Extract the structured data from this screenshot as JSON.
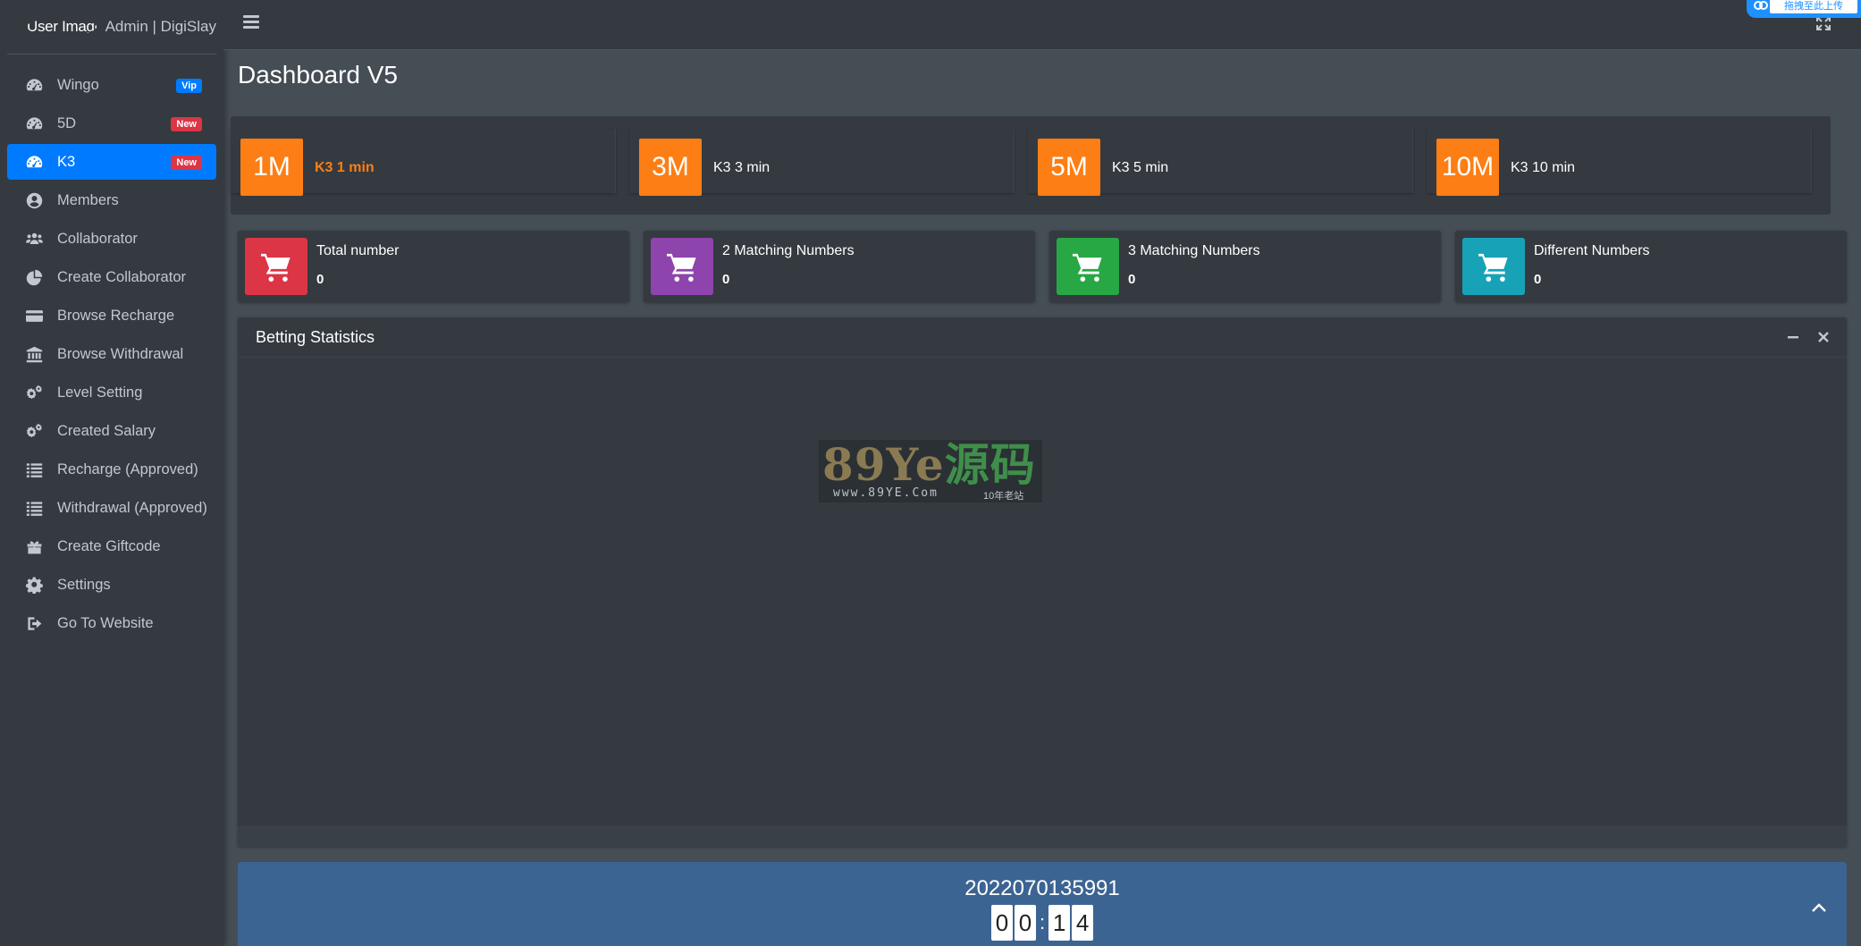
{
  "brand": {
    "image_alt": "User Image",
    "title": "Admin | DigiSlay"
  },
  "sidebar": {
    "items": [
      {
        "label": "Wingo",
        "icon": "tachometer-icon",
        "badge": "Vip",
        "badge_type": "vip",
        "active": false
      },
      {
        "label": "5D",
        "icon": "tachometer-icon",
        "badge": "New",
        "badge_type": "new",
        "active": false
      },
      {
        "label": "K3",
        "icon": "tachometer-icon",
        "badge": "New",
        "badge_type": "new",
        "active": true
      },
      {
        "label": "Members",
        "icon": "user-circle-icon",
        "active": false
      },
      {
        "label": "Collaborator",
        "icon": "users-icon",
        "active": false
      },
      {
        "label": "Create Collaborator",
        "icon": "pie-chart-icon",
        "active": false
      },
      {
        "label": "Browse Recharge",
        "icon": "credit-card-icon",
        "active": false
      },
      {
        "label": "Browse Withdrawal",
        "icon": "bank-icon",
        "active": false
      },
      {
        "label": "Level Setting",
        "icon": "cogs-icon",
        "active": false
      },
      {
        "label": "Created Salary",
        "icon": "cogs-icon",
        "active": false
      },
      {
        "label": "Recharge (Approved)",
        "icon": "list-icon",
        "active": false
      },
      {
        "label": "Withdrawal (Approved)",
        "icon": "list-icon",
        "active": false
      },
      {
        "label": "Create Giftcode",
        "icon": "gift-icon",
        "active": false
      },
      {
        "label": "Settings",
        "icon": "gear-icon",
        "active": false
      },
      {
        "label": "Go To Website",
        "icon": "sign-out-icon",
        "active": false
      }
    ]
  },
  "header": {
    "cloud_label": "拖拽至此上传"
  },
  "page": {
    "title": "Dashboard V5"
  },
  "games": [
    {
      "icon_text": "1M",
      "label": "K3 1 min",
      "active": true
    },
    {
      "icon_text": "3M",
      "label": "K3 3 min",
      "active": false
    },
    {
      "icon_text": "5M",
      "label": "K3 5 min",
      "active": false
    },
    {
      "icon_text": "10M",
      "label": "K3 10 min",
      "active": false
    }
  ],
  "stats": [
    {
      "label": "Total number",
      "value": "0",
      "color": "#dc3545"
    },
    {
      "label": "2 Matching Numbers",
      "value": "0",
      "color": "#8e44ad"
    },
    {
      "label": "3 Matching Numbers",
      "value": "0",
      "color": "#28a745"
    },
    {
      "label": "Different Numbers",
      "value": "0",
      "color": "#17a2b8"
    }
  ],
  "betting": {
    "title": "Betting Statistics"
  },
  "watermark": {
    "logo": "89Ye",
    "logo_cn": "源码",
    "url": "www.89YE.Com",
    "tag": "10年老站"
  },
  "period": {
    "number": "2022070135991",
    "timer_digits": [
      "0",
      "0",
      "1",
      "4"
    ]
  },
  "colors": {
    "accent": "#007bff",
    "orange": "#fd7e14",
    "sidebar_bg": "#343a40",
    "content_bg": "#454d55",
    "period_bg": "#3c6492"
  }
}
